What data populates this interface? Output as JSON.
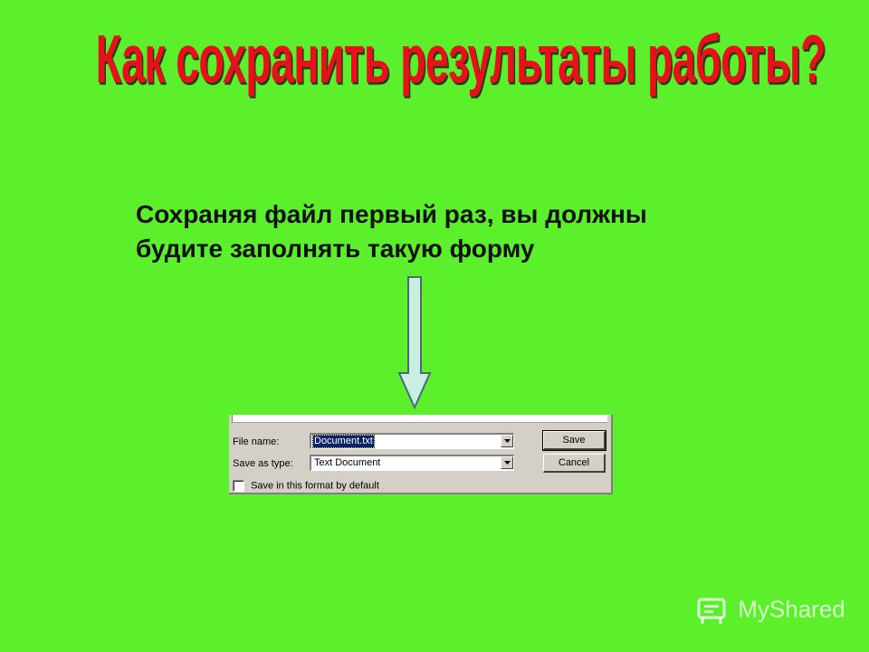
{
  "slide": {
    "title": "Как сохранить результаты работы?",
    "text_line1": "Сохраняя файл первый раз, вы должны",
    "text_line2": "будите заполнять такую форму"
  },
  "dialog": {
    "file_name_label": "File name:",
    "file_name_value": "Document.txt",
    "save_as_type_label": "Save as type:",
    "save_as_type_value": "Text Document",
    "save_button": "Save",
    "cancel_button": "Cancel",
    "default_format_checkbox_label": "Save in this format by default",
    "default_format_checked": false
  },
  "watermark": {
    "text": "MyShared"
  },
  "icons": [
    "down-arrow-icon",
    "dropdown-arrow-icon",
    "checkbox",
    "myshared-logo-icon"
  ],
  "colors": {
    "background": "#5cef2c",
    "title": "#e8101a",
    "arrow_fill": "#c8efe2",
    "dialog_face": "#d4d0c8",
    "selection": "#0a246a"
  }
}
